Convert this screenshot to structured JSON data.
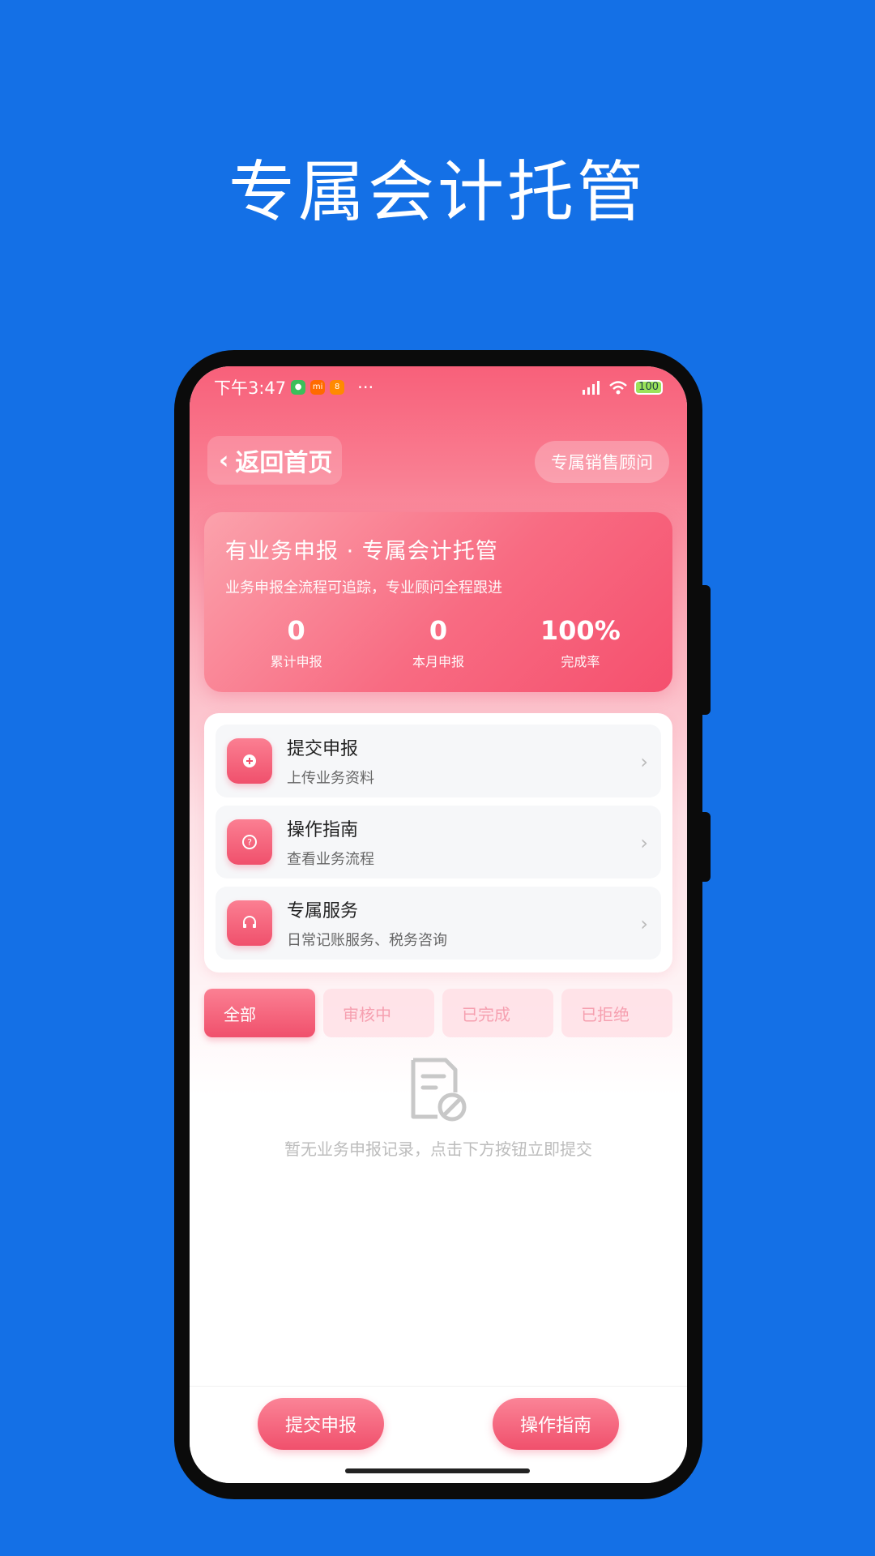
{
  "hero": {
    "title": "专属会计托管"
  },
  "status_bar": {
    "time": "下午3:47",
    "more": "···",
    "battery": "100"
  },
  "header": {
    "back_label": "返回首页",
    "advisor_label": "专属销售顾问"
  },
  "summary": {
    "title": "有业务申报 · 专属会计托管",
    "subtitle": "业务申报全流程可追踪，专业顾问全程跟进",
    "stats": [
      {
        "value": "0",
        "label": "累计申报"
      },
      {
        "value": "0",
        "label": "本月申报"
      },
      {
        "value": "100%",
        "label": "完成率"
      }
    ]
  },
  "menu": [
    {
      "title": "提交申报",
      "desc": "上传业务资料",
      "icon": "plus-circle-icon"
    },
    {
      "title": "操作指南",
      "desc": "查看业务流程",
      "icon": "question-icon"
    },
    {
      "title": "专属服务",
      "desc": "日常记账服务、税务咨询",
      "icon": "headset-icon"
    }
  ],
  "tabs": [
    "全部",
    "审核中",
    "已完成",
    "已拒绝"
  ],
  "empty": {
    "text": "暂无业务申报记录，点击下方按钮立即提交"
  },
  "bottom": {
    "submit_label": "提交申报",
    "guide_label": "操作指南"
  },
  "colors": {
    "brand_blue": "#1470e6",
    "accent_pink": "#f0506c"
  }
}
